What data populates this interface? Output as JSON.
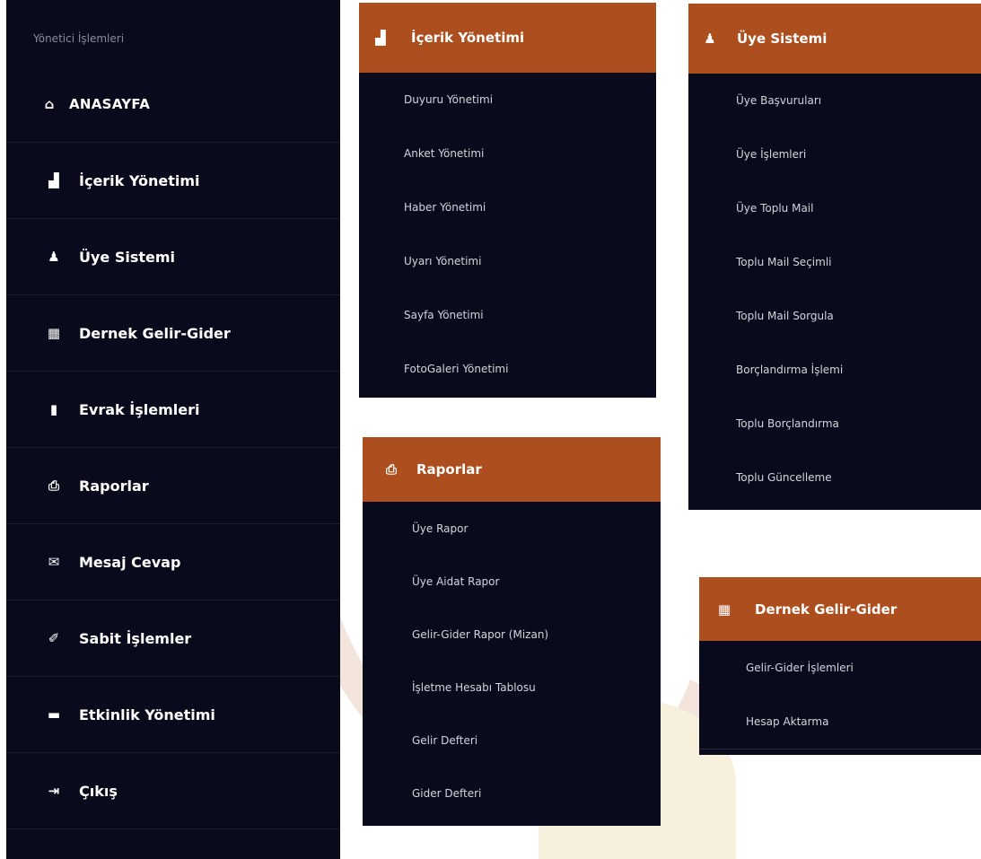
{
  "sidebar": {
    "caption": "Yönetici İşlemleri",
    "items": [
      {
        "icon": "home-icon",
        "glyph": "⌂",
        "label": "ANASAYFA"
      },
      {
        "icon": "monitor-icon",
        "glyph": "▟",
        "label": "İçerik Yönetimi"
      },
      {
        "icon": "user-icon",
        "glyph": "♟",
        "label": "Üye Sistemi"
      },
      {
        "icon": "calendar-icon",
        "glyph": "▦",
        "label": "Dernek Gelir-Gider"
      },
      {
        "icon": "file-icon",
        "glyph": "▮",
        "label": "Evrak İşlemleri"
      },
      {
        "icon": "print-icon",
        "glyph": "⎙",
        "label": "Raporlar"
      },
      {
        "icon": "envelope-icon",
        "glyph": "✉",
        "label": "Mesaj Cevap"
      },
      {
        "icon": "pushpin-icon",
        "glyph": "✐",
        "label": "Sabit İşlemler"
      },
      {
        "icon": "comment-icon",
        "glyph": "▬",
        "label": "Etkinlik Yönetimi"
      },
      {
        "icon": "logout-icon",
        "glyph": "⇥",
        "label": "Çıkış"
      }
    ]
  },
  "menus": {
    "icerik": {
      "title": "İçerik Yönetimi",
      "icon": "monitor-icon",
      "items": [
        "Duyuru Yönetimi",
        "Anket Yönetimi",
        "Haber Yönetimi",
        "Uyarı Yönetimi",
        "Sayfa Yönetimi",
        "FotoGaleri Yönetimi"
      ]
    },
    "uye": {
      "title": "Üye Sistemi",
      "icon": "user-icon",
      "items": [
        "Üye Başvuruları",
        "Üye İşlemleri",
        "Üye Toplu Mail",
        "Toplu Mail Seçimli",
        "Toplu Mail Sorgula",
        "Borçlandırma İşlemi",
        "Toplu Borçlandırma",
        "Toplu Güncelleme"
      ]
    },
    "rapor": {
      "title": "Raporlar",
      "icon": "print-icon",
      "items": [
        "Üye Rapor",
        "Üye Aidat Rapor",
        "Gelir-Gider Rapor (Mizan)",
        "İşletme Hesabı Tablosu",
        "Gelir Defteri",
        "Gider Defteri"
      ]
    },
    "gelir": {
      "title": "Dernek Gelir-Gider",
      "icon": "calendar-icon",
      "items": [
        "Gelir-Gider İşlemleri",
        "Hesap Aktarma"
      ]
    }
  },
  "colors": {
    "panel_bg": "#090b1c",
    "header_bg": "#ac4e1d",
    "item_text": "#d4d5da"
  }
}
